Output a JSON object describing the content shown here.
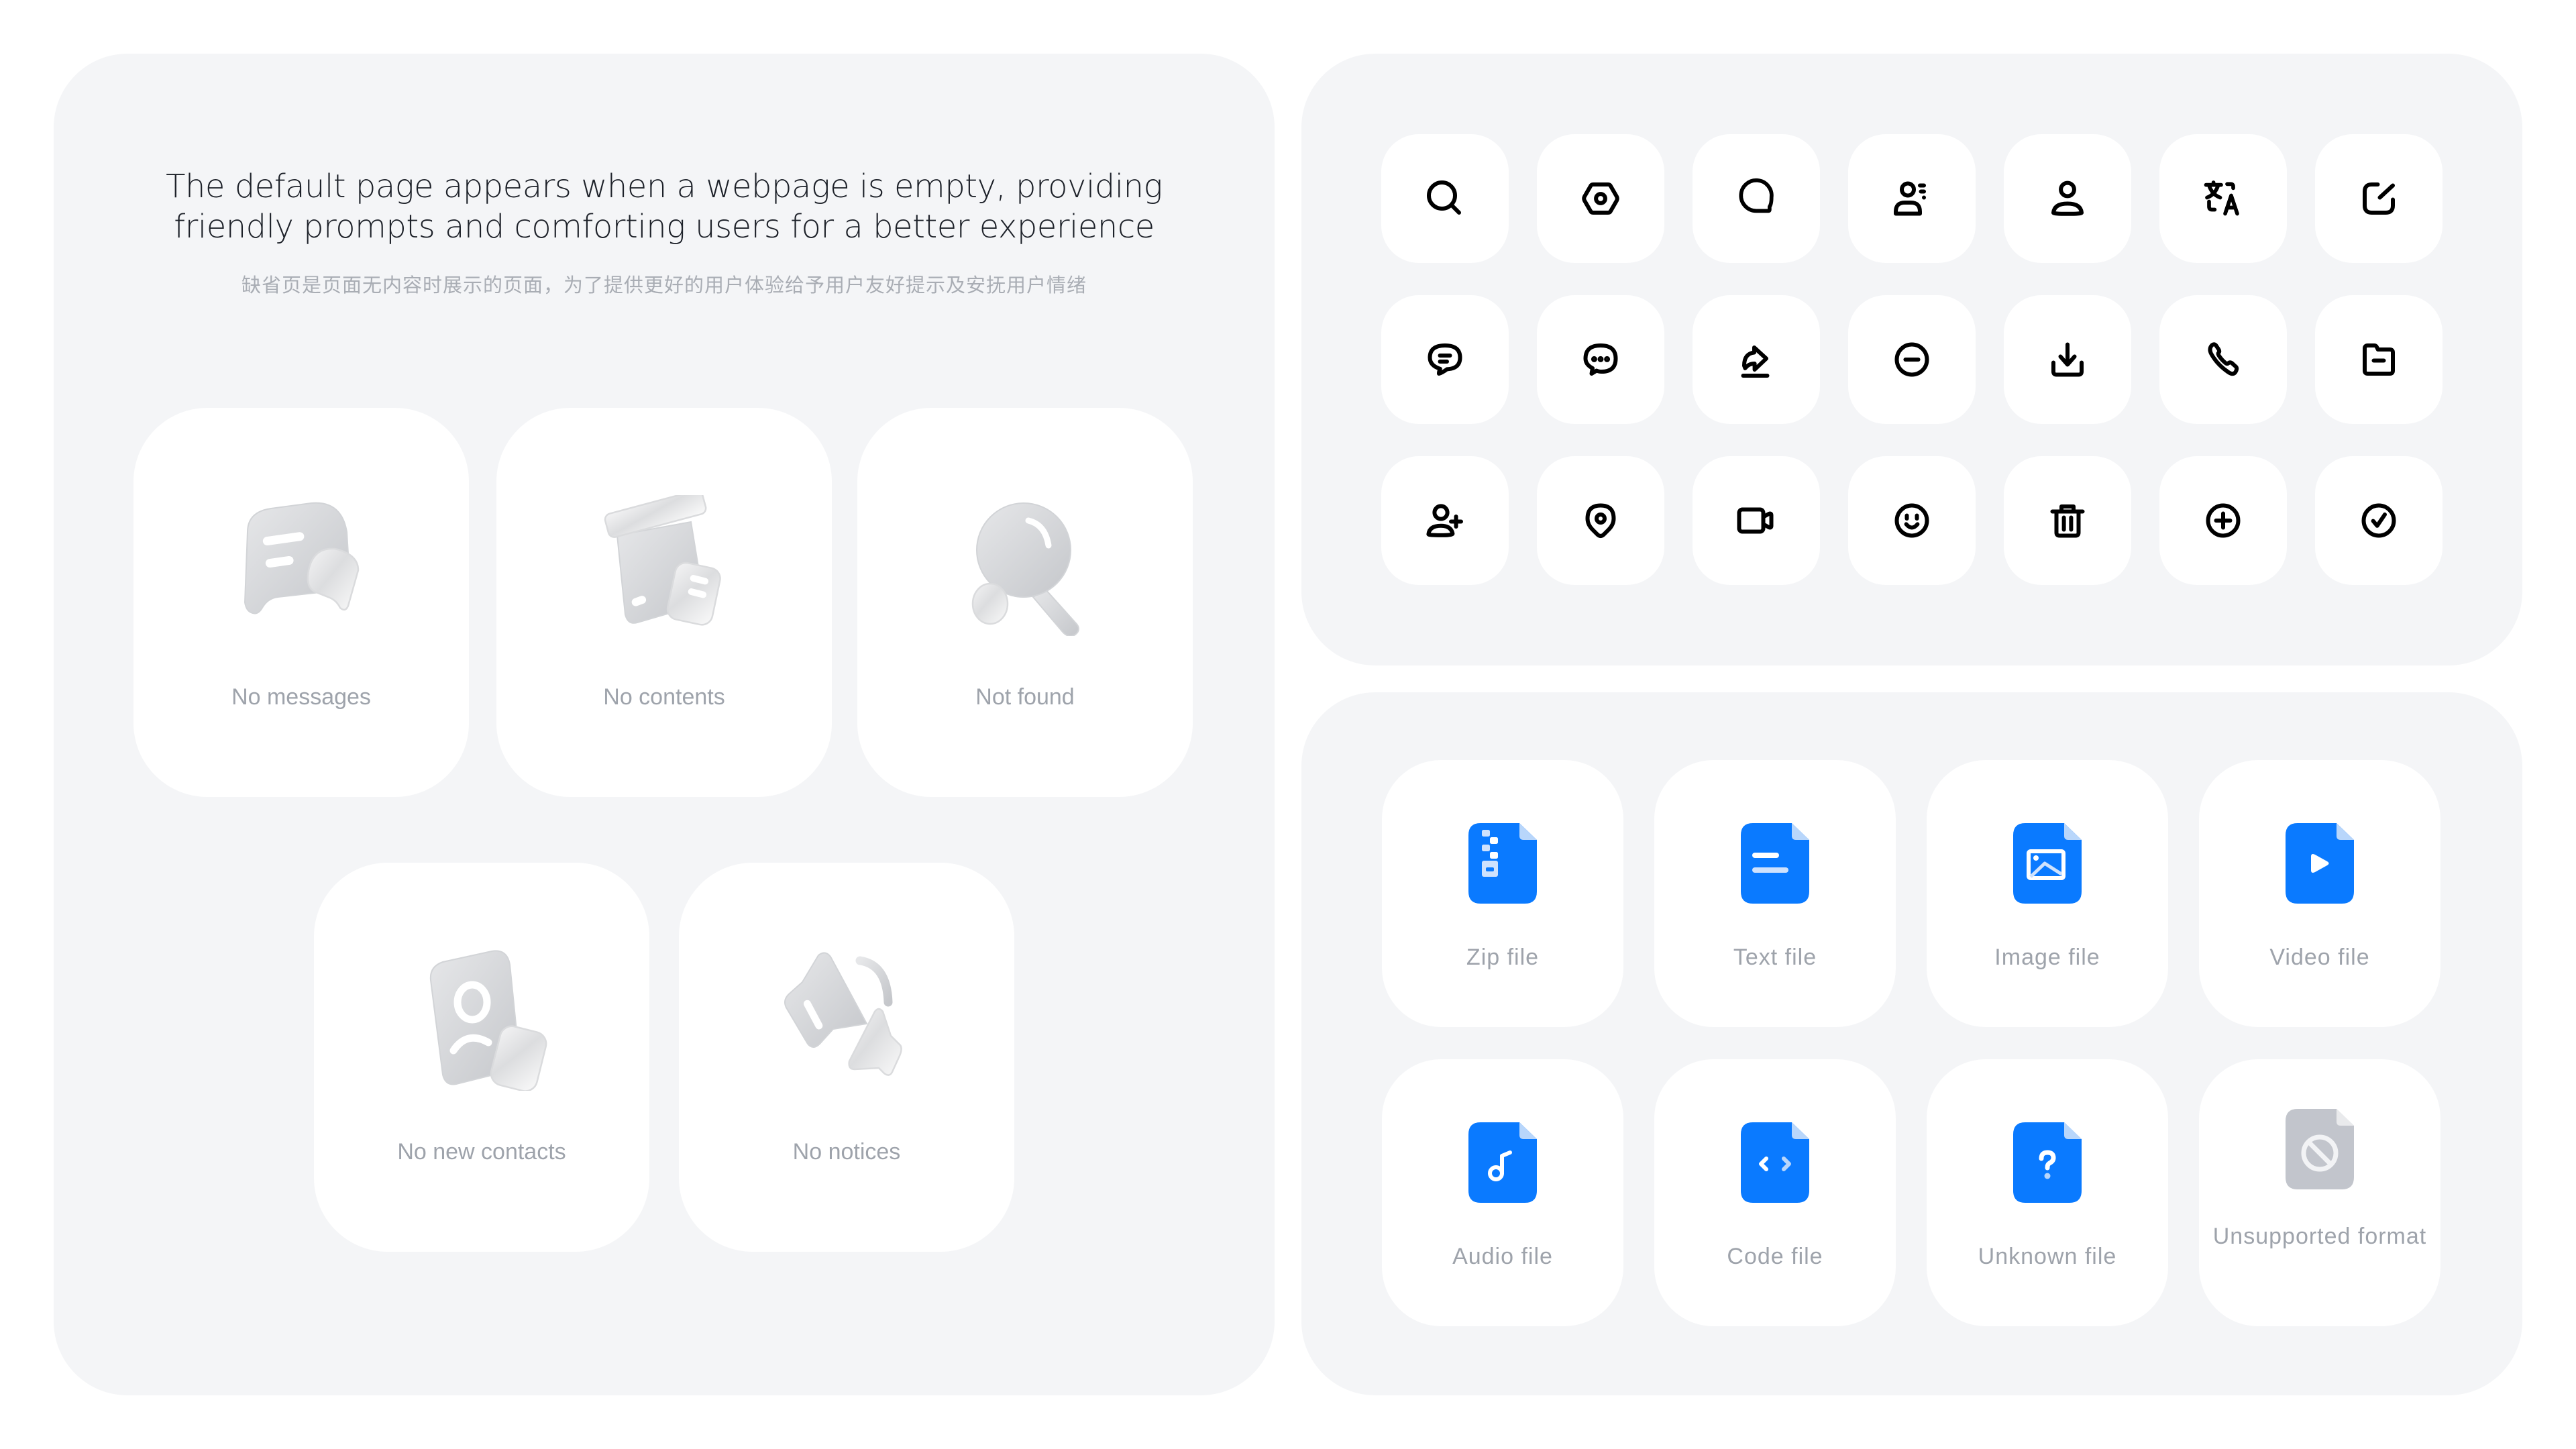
{
  "intro": {
    "title_lines": [
      "The default page appears when a webpage is empty, providing",
      "friendly prompts and comforting users for a better experience"
    ],
    "subtitle": "缺省页是页面无内容时展示的页面，为了提供更好的用户体验给予用户友好提示及安抚用户情绪"
  },
  "empty_states": [
    {
      "label": "No messages",
      "icon": "message-bubble-illustration"
    },
    {
      "label": "No contents",
      "icon": "open-box-illustration"
    },
    {
      "label": "Not found",
      "icon": "magnifier-illustration"
    },
    {
      "label": "No new contacts",
      "icon": "contact-card-illustration"
    },
    {
      "label": "No notices",
      "icon": "megaphone-illustration"
    }
  ],
  "icon_grid": [
    [
      "search",
      "settings-nut",
      "chat-bubble",
      "contact-list",
      "user",
      "translate",
      "edit"
    ],
    [
      "chat-text",
      "chat-dots",
      "share",
      "minus-circle",
      "download",
      "phone",
      "folder-minus"
    ],
    [
      "user-add",
      "location",
      "video-camera",
      "smile",
      "trash",
      "plus-circle",
      "check-circle"
    ]
  ],
  "file_types": [
    {
      "label": "Zip file",
      "icon": "zip-file"
    },
    {
      "label": "Text file",
      "icon": "text-file"
    },
    {
      "label": "Image file",
      "icon": "image-file"
    },
    {
      "label": "Video file",
      "icon": "video-file"
    },
    {
      "label": "Audio file",
      "icon": "audio-file"
    },
    {
      "label": "Code file",
      "icon": "code-file"
    },
    {
      "label": "Unknown file",
      "icon": "unknown-file"
    },
    {
      "label": "Unsupported format",
      "icon": "unsupported-file"
    }
  ],
  "colors": {
    "panel_bg": "#f4f5f7",
    "card_bg": "#ffffff",
    "title_text": "#1d2129",
    "muted_text": "#9ea3ab",
    "file_blue": "#0a7aff",
    "file_blue_light": "#b8d6fb",
    "file_gray": "#c2c5cc",
    "file_gray_light": "#e9eaec",
    "icon_stroke": "#000000"
  }
}
